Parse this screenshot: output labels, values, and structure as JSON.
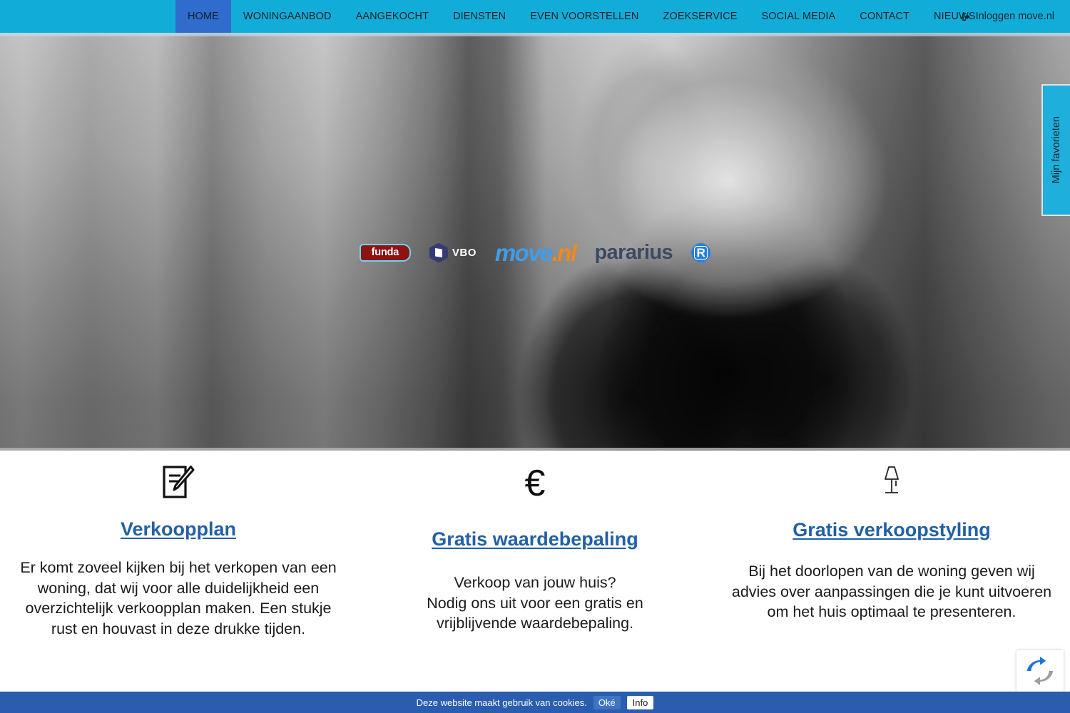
{
  "nav": {
    "items": [
      {
        "label": "HOME",
        "active": true
      },
      {
        "label": "WONINGAANBOD",
        "active": false
      },
      {
        "label": "AANGEKOCHT",
        "active": false
      },
      {
        "label": "DIENSTEN",
        "active": false
      },
      {
        "label": "EVEN VOORSTELLEN",
        "active": false
      },
      {
        "label": "ZOEKSERVICE",
        "active": false
      },
      {
        "label": "SOCIAL MEDIA",
        "active": false
      },
      {
        "label": "CONTACT",
        "active": false
      },
      {
        "label": "NIEUWS",
        "active": false
      }
    ],
    "login_label": "Inloggen move.nl",
    "login_icon": "sign-in-icon",
    "background_color": "#11ADD8",
    "active_color": "#2F6CCB"
  },
  "hero": {
    "favorites_tab": "Mijn favorieten",
    "favorites_tab_color": "#1FAFDD",
    "logos": [
      {
        "name": "funda",
        "text": "funda"
      },
      {
        "name": "vbo",
        "text": "VBO"
      },
      {
        "name": "move-nl",
        "text": "move",
        "suffix": ".nl"
      },
      {
        "name": "pararius",
        "text": "pararius"
      },
      {
        "name": "realworks",
        "text": "R"
      }
    ]
  },
  "features": [
    {
      "icon": "document-pencil-icon",
      "title": "Verkoopplan",
      "body": "Er komt zoveel kijken bij het verkopen van een woning, dat wij voor alle duidelijkheid een overzichtelijk verkoopplan maken. Een stukje rust en houvast in deze drukke tijden."
    },
    {
      "icon": "euro-icon",
      "title": "Gratis waardebepaling",
      "body": "Verkoop van jouw huis?\nNodig ons uit voor een gratis en vrijblijvende waardebepaling."
    },
    {
      "icon": "table-lamp-icon",
      "title": "Gratis verkoopstyling",
      "body": "Bij het doorlopen van de woning geven wij advies over aanpassingen die je kunt uitvoeren om het huis optimaal te presenteren."
    }
  ],
  "feature_link_color": "#2360A5",
  "recaptcha": {
    "icon": "recaptcha-icon"
  },
  "cookiebar": {
    "text": "Deze website maakt gebruik van cookies.",
    "ok_label": "Oké",
    "info_label": "Info",
    "background_color": "#2B5DAF"
  }
}
